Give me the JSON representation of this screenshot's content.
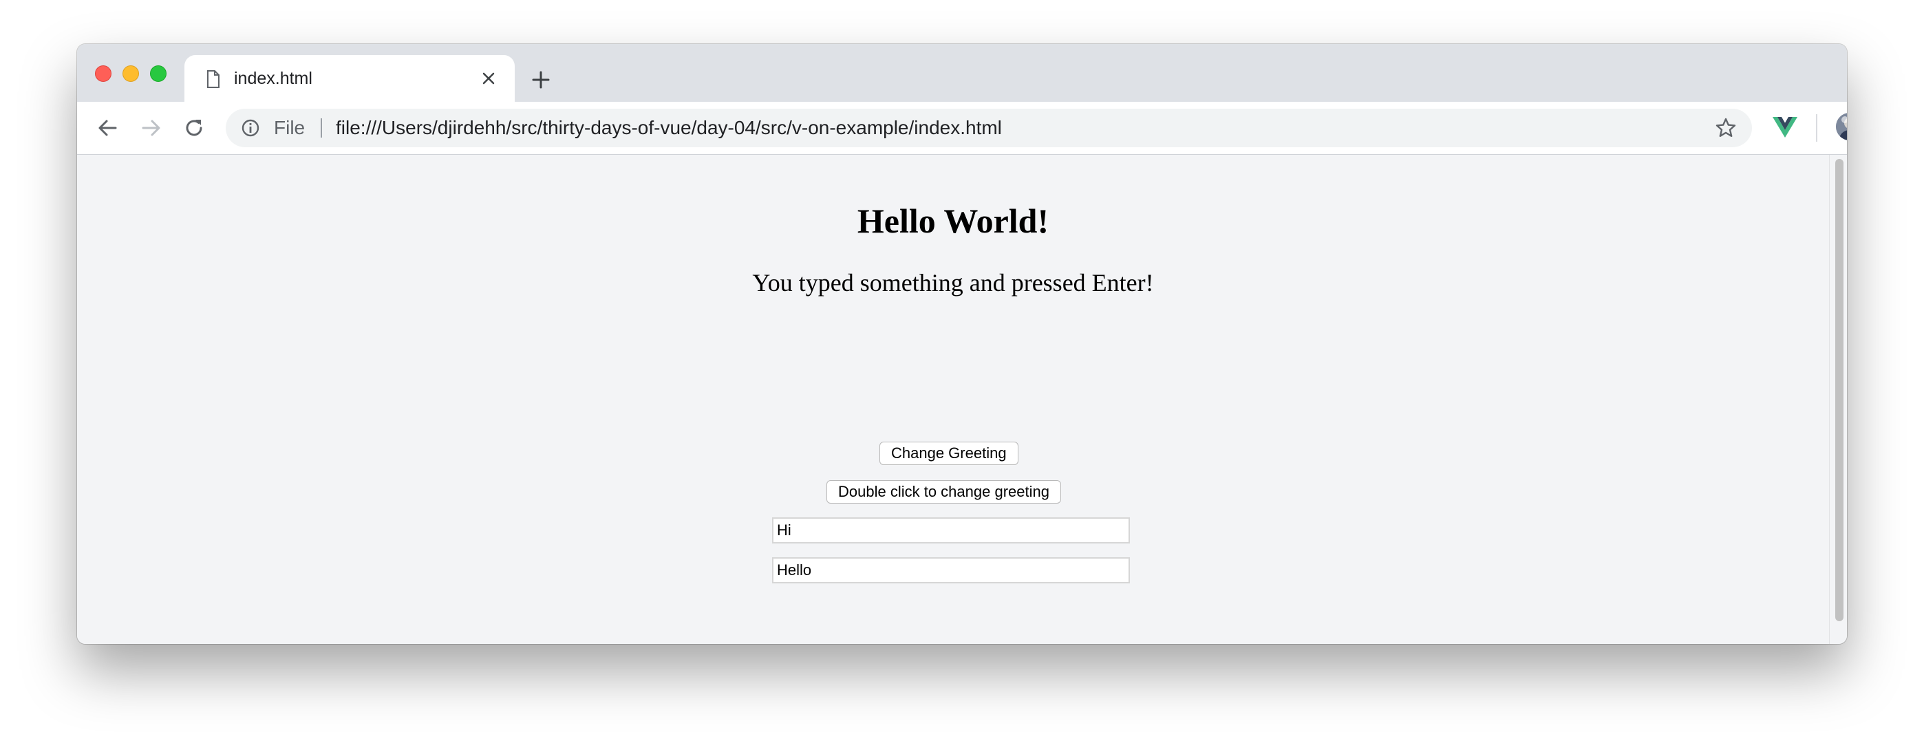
{
  "browser": {
    "tab_title": "index.html",
    "omnibox_scheme_label": "File",
    "url": "file:///Users/djirdehh/src/thirty-days-of-vue/day-04/src/v-on-example/index.html"
  },
  "page": {
    "heading": "Hello World!",
    "message": "You typed something and pressed Enter!",
    "change_greeting_label": "Change Greeting",
    "double_click_label": "Double click to change greeting",
    "input1_value": "Hi",
    "input2_value": "Hello"
  },
  "icons": {
    "tab": "file-icon",
    "close": "close-icon",
    "new_tab": "plus-icon",
    "back": "back-arrow-icon",
    "forward": "forward-arrow-icon",
    "reload": "reload-icon",
    "info": "info-icon",
    "star": "star-icon",
    "extension": "vue-devtools-icon",
    "menu": "kebab-menu-icon"
  },
  "colors": {
    "titlebar": "#dee1e6",
    "page_background": "#f3f4f6",
    "vue_green": "#41b883",
    "vue_dark": "#35495e"
  }
}
